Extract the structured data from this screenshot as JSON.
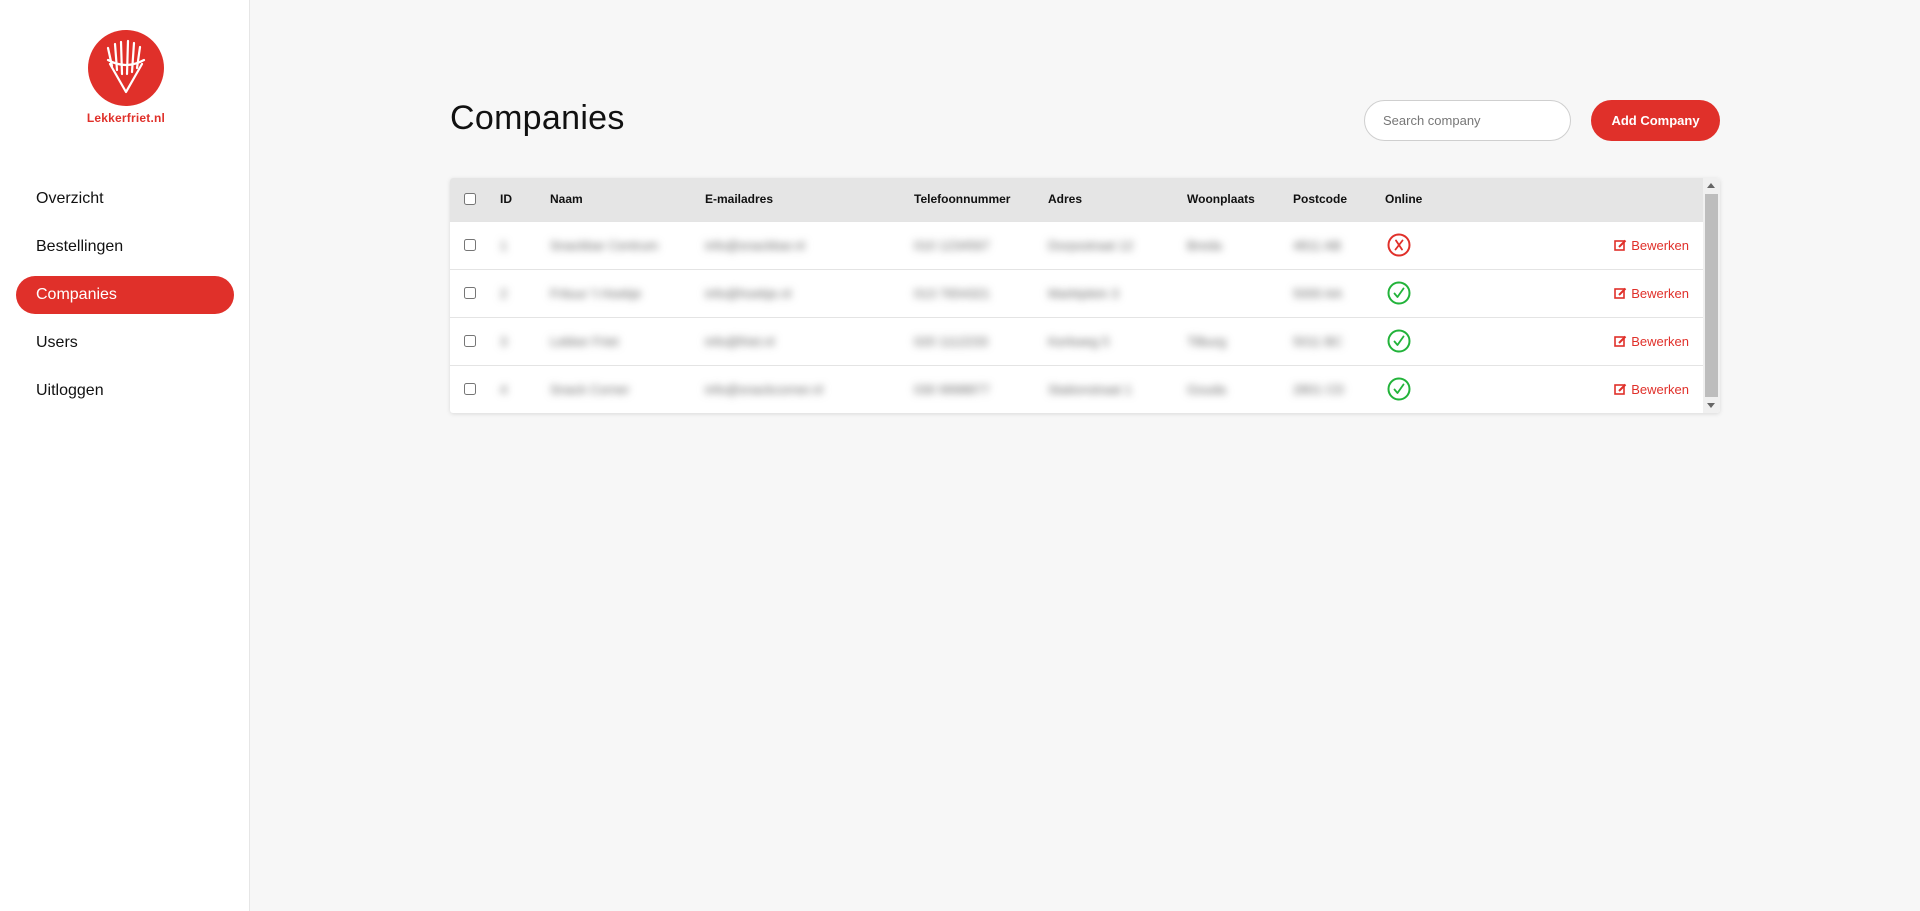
{
  "brand": {
    "name": "Lekkerfriet.nl",
    "accent_color": "#e0302a",
    "logo_icon": "fries-icon"
  },
  "sidebar": {
    "items": [
      {
        "label": "Overzicht",
        "active": false
      },
      {
        "label": "Bestellingen",
        "active": false
      },
      {
        "label": "Companies",
        "active": true
      },
      {
        "label": "Users",
        "active": false
      },
      {
        "label": "Uitloggen",
        "active": false
      }
    ]
  },
  "header": {
    "title": "Companies",
    "search_placeholder": "Search company",
    "add_button": "Add Company"
  },
  "table": {
    "columns": [
      "ID",
      "Naam",
      "E-mailadres",
      "Telefoonnummer",
      "Adres",
      "Woonplaats",
      "Postcode",
      "Online"
    ],
    "edit_label": "Bewerken",
    "rows": [
      {
        "id": "1",
        "naam": "Snackbar Centrum",
        "email": "info@snackbar.nl",
        "telefoon": "010 1234567",
        "adres": "Dorpsstraat 12",
        "woonplaats": "Breda",
        "postcode": "4811 AB",
        "online": false
      },
      {
        "id": "2",
        "naam": "Frituur 't Hoekje",
        "email": "info@hoekje.nl",
        "telefoon": "013 7654321",
        "adres": "Marktplein 3",
        "woonplaats": "",
        "postcode": "5000 AA",
        "online": true
      },
      {
        "id": "3",
        "naam": "Lekker Friet",
        "email": "info@friet.nl",
        "telefoon": "020 1112233",
        "adres": "Kerkweg 5",
        "woonplaats": "Tilburg",
        "postcode": "5011 BC",
        "online": true
      },
      {
        "id": "4",
        "naam": "Snack Corner",
        "email": "info@snackcorner.nl",
        "telefoon": "030 9998877",
        "adres": "Stationstraat 1",
        "woonplaats": "Gouda",
        "postcode": "2801 CD",
        "online": true
      }
    ]
  }
}
